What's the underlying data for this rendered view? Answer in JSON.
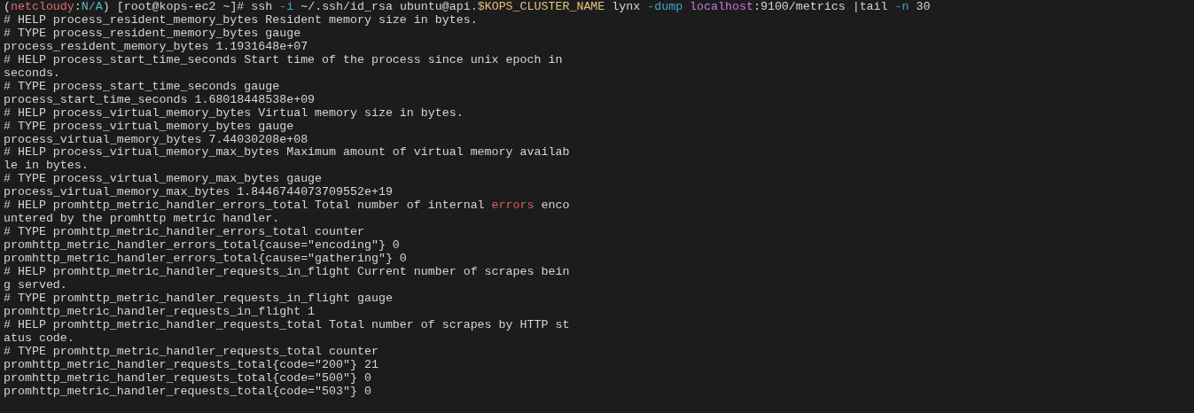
{
  "terminal": {
    "lines": [
      [
        {
          "text": "(",
          "kind": "plain"
        },
        {
          "text": "netcloudy",
          "kind": "context"
        },
        {
          "text": ":",
          "kind": "plain"
        },
        {
          "text": "N/A",
          "kind": "namespace"
        },
        {
          "text": ") [root@kops-ec2 ~]# ssh ",
          "kind": "plain"
        },
        {
          "text": "-i",
          "kind": "option"
        },
        {
          "text": " ~/.ssh/id_rsa ubuntu@api.",
          "kind": "plain"
        },
        {
          "text": "$KOPS_CLUSTER_NAME",
          "kind": "variable"
        },
        {
          "text": " lynx ",
          "kind": "plain"
        },
        {
          "text": "-dump ",
          "kind": "option"
        },
        {
          "text": "localhost",
          "kind": "host"
        },
        {
          "text": ":9100/metrics |tail ",
          "kind": "plain"
        },
        {
          "text": "-n",
          "kind": "option"
        },
        {
          "text": " 30",
          "kind": "plain"
        }
      ],
      [
        {
          "text": "# HELP process_resident_memory_bytes Resident memory size in bytes.",
          "kind": "plain"
        }
      ],
      [
        {
          "text": "# TYPE process_resident_memory_bytes gauge",
          "kind": "plain"
        }
      ],
      [
        {
          "text": "process_resident_memory_bytes 1.1931648e+07",
          "kind": "plain"
        }
      ],
      [
        {
          "text": "# HELP process_start_time_seconds Start time of the process since unix epoch in",
          "kind": "plain"
        }
      ],
      [
        {
          "text": "seconds.",
          "kind": "plain"
        }
      ],
      [
        {
          "text": "# TYPE process_start_time_seconds gauge",
          "kind": "plain"
        }
      ],
      [
        {
          "text": "process_start_time_seconds 1.68018448538e+09",
          "kind": "plain"
        }
      ],
      [
        {
          "text": "# HELP process_virtual_memory_bytes Virtual memory size in bytes.",
          "kind": "plain"
        }
      ],
      [
        {
          "text": "# TYPE process_virtual_memory_bytes gauge",
          "kind": "plain"
        }
      ],
      [
        {
          "text": "process_virtual_memory_bytes 7.44030208e+08",
          "kind": "plain"
        }
      ],
      [
        {
          "text": "# HELP process_virtual_memory_max_bytes Maximum amount of virtual memory availab",
          "kind": "plain"
        }
      ],
      [
        {
          "text": "le in bytes.",
          "kind": "plain"
        }
      ],
      [
        {
          "text": "# TYPE process_virtual_memory_max_bytes gauge",
          "kind": "plain"
        }
      ],
      [
        {
          "text": "process_virtual_memory_max_bytes 1.8446744073709552e+19",
          "kind": "plain"
        }
      ],
      [
        {
          "text": "# HELP promhttp_metric_handler_errors_total Total number of internal ",
          "kind": "plain"
        },
        {
          "text": "errors",
          "kind": "error"
        },
        {
          "text": " enco",
          "kind": "plain"
        }
      ],
      [
        {
          "text": "untered by the promhttp metric handler.",
          "kind": "plain"
        }
      ],
      [
        {
          "text": "# TYPE promhttp_metric_handler_errors_total counter",
          "kind": "plain"
        }
      ],
      [
        {
          "text": "promhttp_metric_handler_errors_total{cause=\"encoding\"} 0",
          "kind": "plain"
        }
      ],
      [
        {
          "text": "promhttp_metric_handler_errors_total{cause=\"gathering\"} 0",
          "kind": "plain"
        }
      ],
      [
        {
          "text": "# HELP promhttp_metric_handler_requests_in_flight Current number of scrapes bein",
          "kind": "plain"
        }
      ],
      [
        {
          "text": "g served.",
          "kind": "plain"
        }
      ],
      [
        {
          "text": "# TYPE promhttp_metric_handler_requests_in_flight gauge",
          "kind": "plain"
        }
      ],
      [
        {
          "text": "promhttp_metric_handler_requests_in_flight 1",
          "kind": "plain"
        }
      ],
      [
        {
          "text": "# HELP promhttp_metric_handler_requests_total Total number of scrapes by HTTP st",
          "kind": "plain"
        }
      ],
      [
        {
          "text": "atus code.",
          "kind": "plain"
        }
      ],
      [
        {
          "text": "# TYPE promhttp_metric_handler_requests_total counter",
          "kind": "plain"
        }
      ],
      [
        {
          "text": "promhttp_metric_handler_requests_total{code=\"200\"} 21",
          "kind": "plain"
        }
      ],
      [
        {
          "text": "promhttp_metric_handler_requests_total{code=\"500\"} 0",
          "kind": "plain"
        }
      ],
      [
        {
          "text": "promhttp_metric_handler_requests_total{code=\"503\"} 0",
          "kind": "plain"
        }
      ]
    ]
  }
}
